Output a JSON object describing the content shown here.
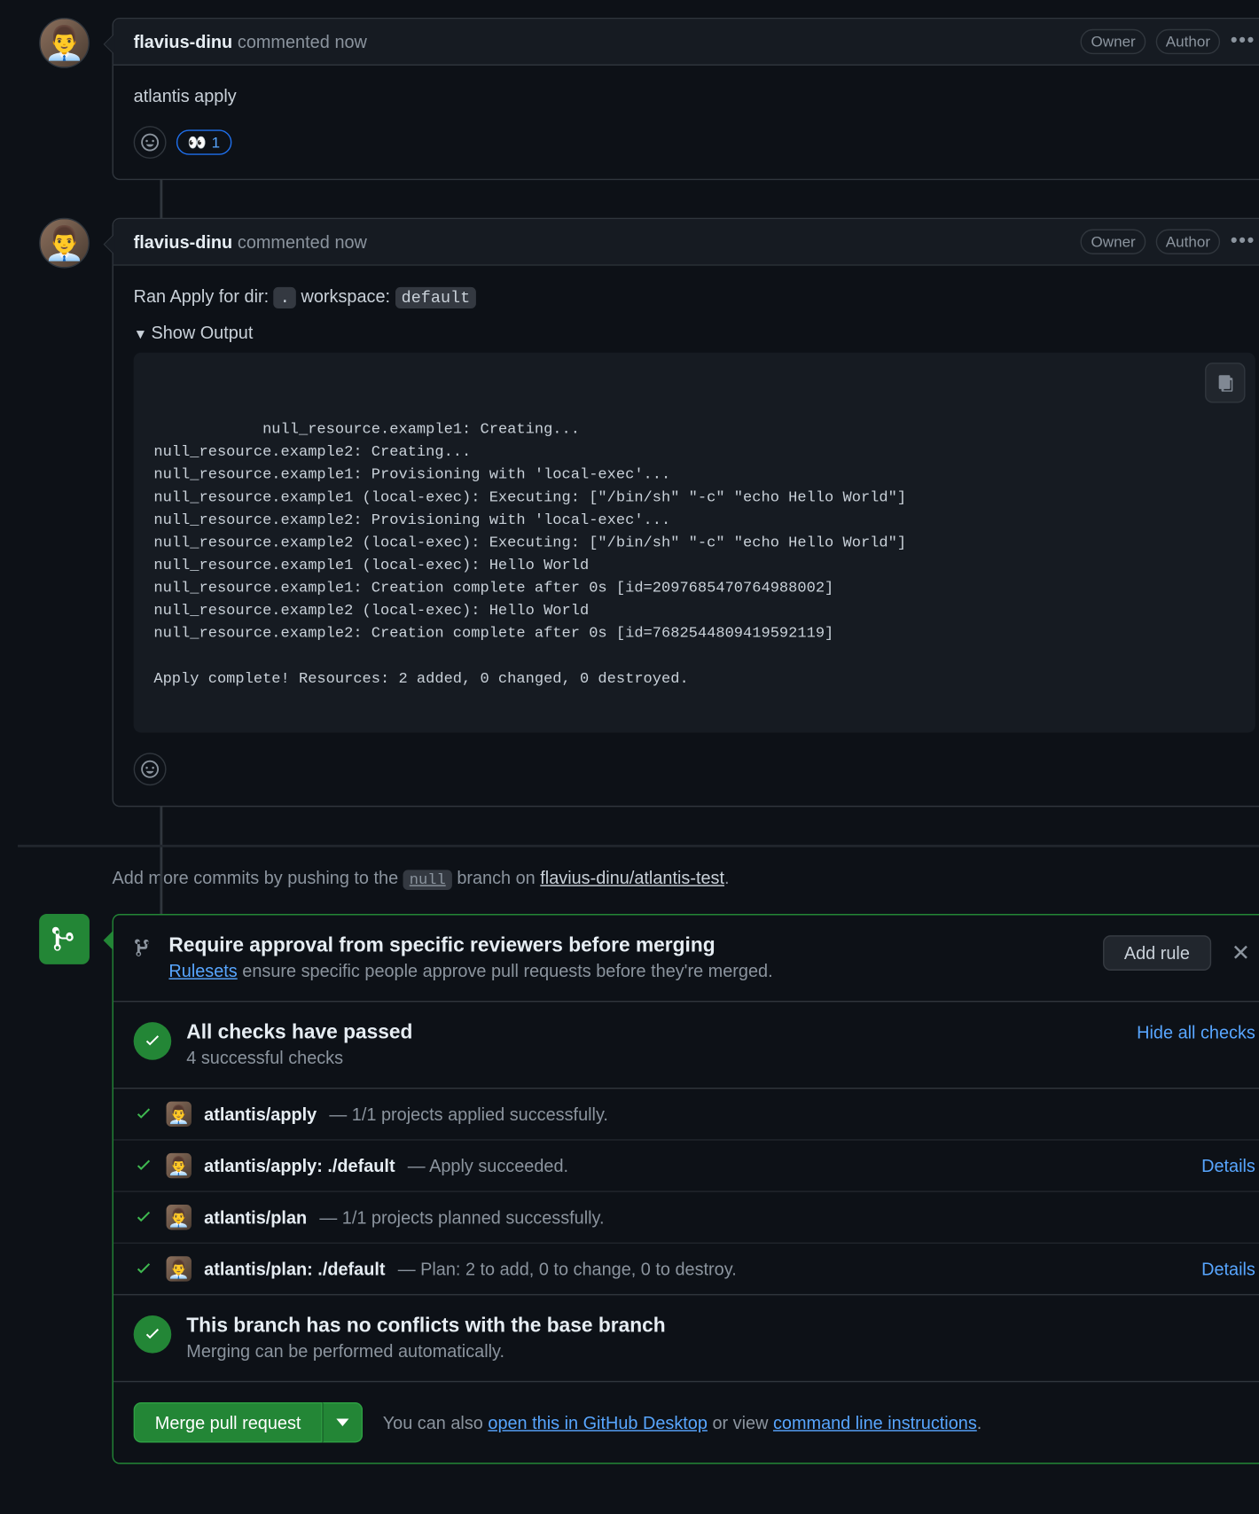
{
  "comments": [
    {
      "author": "flavius-dinu",
      "action": "commented",
      "time": "now",
      "badges": [
        "Owner",
        "Author"
      ],
      "body": "atlantis apply",
      "eyes_reaction_count": "1"
    },
    {
      "author": "flavius-dinu",
      "action": "commented",
      "time": "now",
      "badges": [
        "Owner",
        "Author"
      ],
      "ran_prefix": "Ran Apply for dir: ",
      "dir": ".",
      "ws_label": " workspace: ",
      "ws": "default",
      "details_summary": "Show Output",
      "output": "null_resource.example1: Creating...\nnull_resource.example2: Creating...\nnull_resource.example1: Provisioning with 'local-exec'...\nnull_resource.example1 (local-exec): Executing: [\"/bin/sh\" \"-c\" \"echo Hello World\"]\nnull_resource.example2: Provisioning with 'local-exec'...\nnull_resource.example2 (local-exec): Executing: [\"/bin/sh\" \"-c\" \"echo Hello World\"]\nnull_resource.example1 (local-exec): Hello World\nnull_resource.example1: Creation complete after 0s [id=2097685470764988002]\nnull_resource.example2 (local-exec): Hello World\nnull_resource.example2: Creation complete after 0s [id=7682544809419592119]\n\nApply complete! Resources: 2 added, 0 changed, 0 destroyed."
    }
  ],
  "push_hint": {
    "prefix": "Add more commits by pushing to the ",
    "branch": "null",
    "middle": " branch on ",
    "repo": "flavius-dinu/atlantis-test",
    "suffix": "."
  },
  "ruleset": {
    "title": "Require approval from specific reviewers before merging",
    "link": "Rulesets",
    "desc_rest": " ensure specific people approve pull requests before they're merged.",
    "add_btn": "Add rule"
  },
  "checks": {
    "title": "All checks have passed",
    "subtitle": "4 successful checks",
    "hide_link": "Hide all checks",
    "rows": [
      {
        "name": "atlantis/apply",
        "desc": " — 1/1 projects applied successfully.",
        "details": ""
      },
      {
        "name": "atlantis/apply: ./default",
        "desc": " — Apply succeeded.",
        "details": "Details"
      },
      {
        "name": "atlantis/plan",
        "desc": " — 1/1 projects planned successfully.",
        "details": ""
      },
      {
        "name": "atlantis/plan: ./default",
        "desc": " — Plan: 2 to add, 0 to change, 0 to destroy.",
        "details": "Details"
      }
    ]
  },
  "conflicts": {
    "title": "This branch has no conflicts with the base branch",
    "sub": "Merging can be performed automatically."
  },
  "merge": {
    "button": "Merge pull request",
    "hint_prefix": "You can also ",
    "hint_link1": "open this in GitHub Desktop",
    "hint_mid": " or view ",
    "hint_link2": "command line instructions",
    "hint_suffix": "."
  }
}
